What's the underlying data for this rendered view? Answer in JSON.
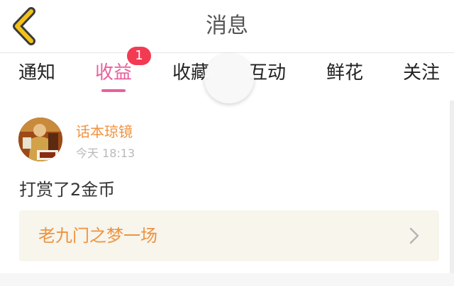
{
  "header": {
    "title": "消息"
  },
  "tabs": [
    {
      "label": "通知"
    },
    {
      "label": "收益",
      "badge": "1"
    },
    {
      "label": "收藏"
    },
    {
      "label": "互动"
    },
    {
      "label": "鲜花"
    },
    {
      "label": "关注"
    }
  ],
  "active_tab": "收益",
  "colors": {
    "accent": "#e8609c",
    "badge": "#f23b52",
    "username": "#f0923d",
    "back_icon": "#f2c21a"
  },
  "message": {
    "user": "话本琼镜",
    "time": "今天 18:13",
    "text": "打赏了2金币",
    "work_title": "老九门之梦一场"
  }
}
